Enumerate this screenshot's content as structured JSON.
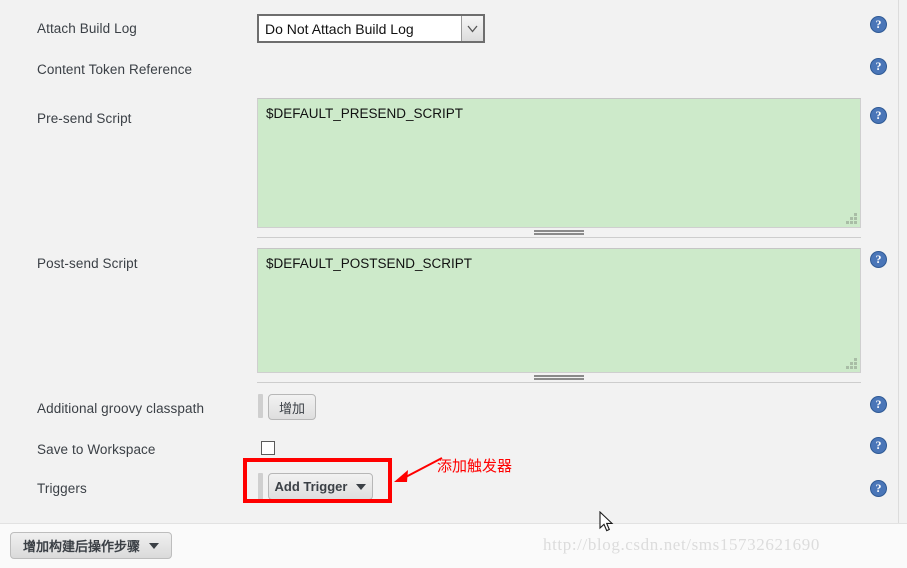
{
  "form": {
    "rows": [
      {
        "label": "Attach Build Log",
        "help": "?"
      },
      {
        "label": "Content Token Reference",
        "help": "?"
      },
      {
        "label": "Pre-send Script",
        "help": "?"
      },
      {
        "label": "Post-send Script",
        "help": "?"
      },
      {
        "label": "Additional groovy classpath",
        "help": "?"
      },
      {
        "label": "Save to Workspace",
        "help": "?"
      },
      {
        "label": "Triggers",
        "help": "?"
      }
    ],
    "attach_build_log": {
      "selected": "Do Not Attach Build Log",
      "options": [
        "Do Not Attach Build Log"
      ]
    },
    "pre_send_script": {
      "value": "$DEFAULT_PRESEND_SCRIPT"
    },
    "post_send_script": {
      "value": "$DEFAULT_POSTSEND_SCRIPT"
    },
    "additional_classpath": {
      "add_label": "增加"
    },
    "save_to_workspace": {
      "checked": false
    },
    "triggers": {
      "add_trigger_label": "Add Trigger"
    }
  },
  "annotation": {
    "text": "添加触发器",
    "color": "#ff0000"
  },
  "bottom": {
    "add_post_build_step_label": "增加构建后操作步骤"
  },
  "watermark": {
    "text": "http://blog.csdn.net/sms15732621690"
  },
  "colors": {
    "page_bg": "#f2f2f2",
    "script_bg": "#cdeaca",
    "help_icon": "#4a76b8",
    "annotation": "#ff0000",
    "label_text": "#3b4046"
  }
}
